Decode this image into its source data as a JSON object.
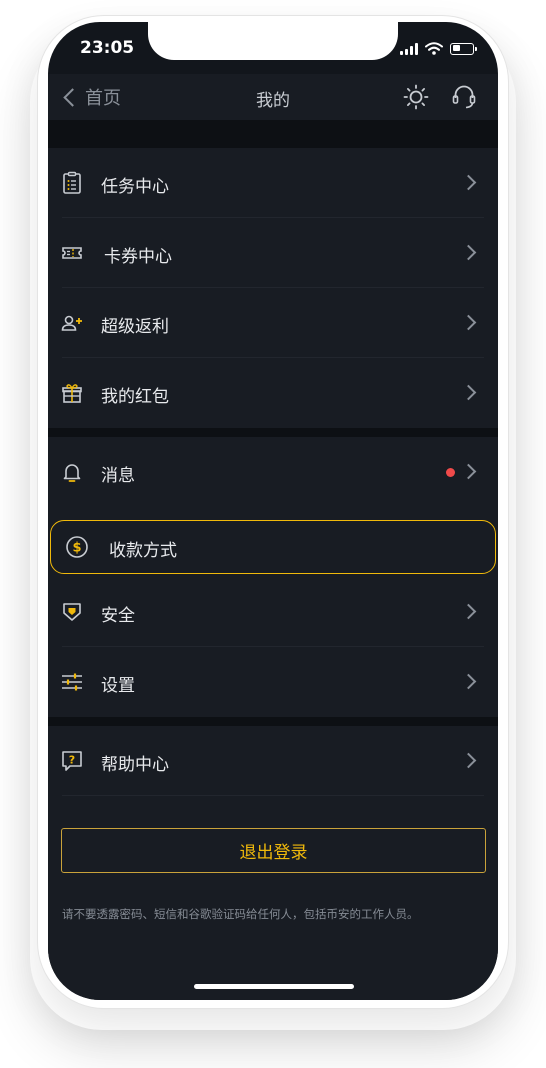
{
  "status_bar": {
    "time": "23:05"
  },
  "nav": {
    "back_label": "首页",
    "title": "我的",
    "icons": [
      "theme-sun-icon",
      "customer-service-icon"
    ]
  },
  "groups": [
    {
      "items": [
        {
          "label": "任务中心",
          "icon": "task-list-icon"
        },
        {
          "label": "卡券中心",
          "icon": "coupon-icon"
        },
        {
          "label": "超级返利",
          "icon": "add-user-icon"
        },
        {
          "label": "我的红包",
          "icon": "gift-icon"
        }
      ]
    },
    {
      "items": [
        {
          "label": "消息",
          "icon": "bell-icon",
          "badge": "red-dot"
        },
        {
          "label": "收款方式",
          "icon": "dollar-coin-icon",
          "highlighted": true
        },
        {
          "label": "安全",
          "icon": "shield-icon"
        },
        {
          "label": "设置",
          "icon": "sliders-icon"
        }
      ]
    },
    {
      "items": [
        {
          "label": "帮助中心",
          "icon": "help-question-icon"
        }
      ]
    }
  ],
  "logout_label": "退出登录",
  "footer_note": "请不要透露密码、短信和谷歌验证码给任何人，包括币安的工作人员。",
  "colors": {
    "background": "#12161c",
    "surface": "#181c23",
    "accent": "#f0b90b",
    "badge": "#f04a4a",
    "text": "#e8eaed"
  }
}
